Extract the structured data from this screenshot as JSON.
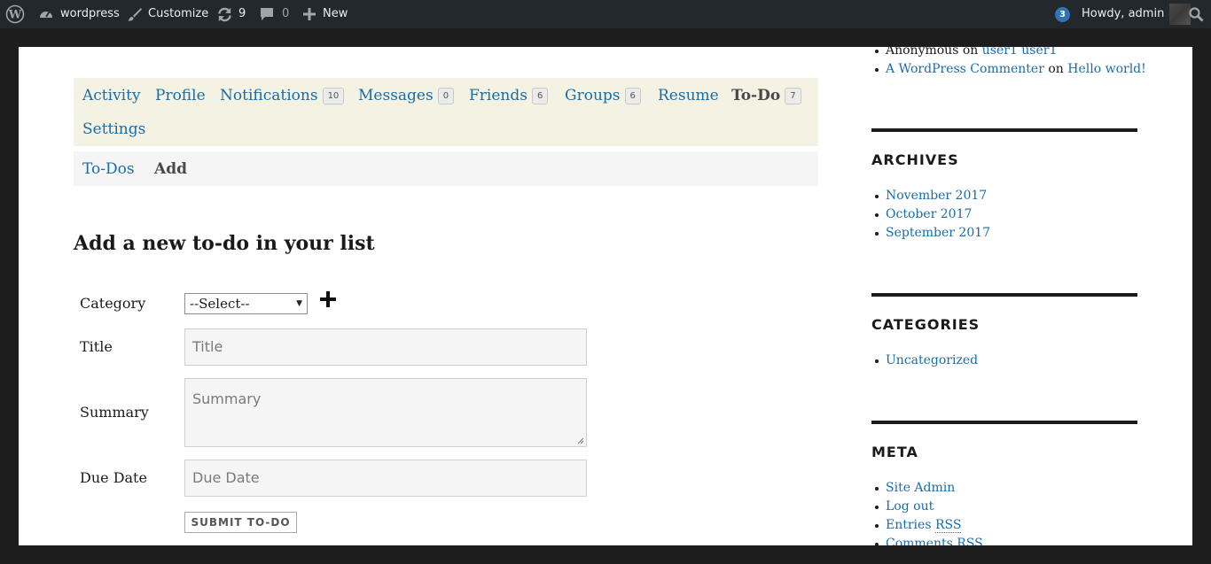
{
  "admin_bar": {
    "site_name": "wordpress",
    "customize": "Customize",
    "updates_count": "9",
    "comments_count": "0",
    "new_label": "New",
    "notifications_badge": "3",
    "howdy": "Howdy, admin"
  },
  "profile_nav": {
    "items": [
      {
        "label": "Activity",
        "count": ""
      },
      {
        "label": "Profile",
        "count": ""
      },
      {
        "label": "Notifications",
        "count": "10"
      },
      {
        "label": "Messages",
        "count": "0"
      },
      {
        "label": "Friends",
        "count": "6"
      },
      {
        "label": "Groups",
        "count": "6"
      },
      {
        "label": "Resume",
        "count": ""
      },
      {
        "label": "To-Do",
        "count": "7"
      },
      {
        "label": "Settings",
        "count": ""
      }
    ]
  },
  "sub_nav": {
    "items": [
      {
        "label": "To-Dos"
      },
      {
        "label": "Add"
      }
    ]
  },
  "form": {
    "title": "Add a new to-do in your list",
    "category_label": "Category",
    "category_selected": "--Select--",
    "title_label": "Title",
    "title_placeholder": "Title",
    "summary_label": "Summary",
    "summary_placeholder": "Summary",
    "due_label": "Due Date",
    "due_placeholder": "Due Date",
    "submit_label": "SUBMIT TO-DO"
  },
  "sidebar": {
    "recent_comments": [
      {
        "author": "Anonymous",
        "on": "on",
        "post": "user1 user1"
      },
      {
        "author": "A WordPress Commenter",
        "on": "on",
        "post": "Hello world!"
      }
    ],
    "archives_title": "ARCHIVES",
    "archives": [
      "November 2017",
      "October 2017",
      "September 2017"
    ],
    "categories_title": "CATEGORIES",
    "categories": [
      "Uncategorized"
    ],
    "meta_title": "META",
    "meta": {
      "site_admin": "Site Admin",
      "log_out": "Log out",
      "entries": "Entries",
      "entries_rss": "RSS",
      "comments": "Comments",
      "comments_rss": "RSS"
    }
  },
  "colors": {
    "admin_bar_bg": "#23282d",
    "link": "#1a6ca6",
    "nav_bg": "#f4f2e3",
    "badge": "#2e74b5"
  }
}
